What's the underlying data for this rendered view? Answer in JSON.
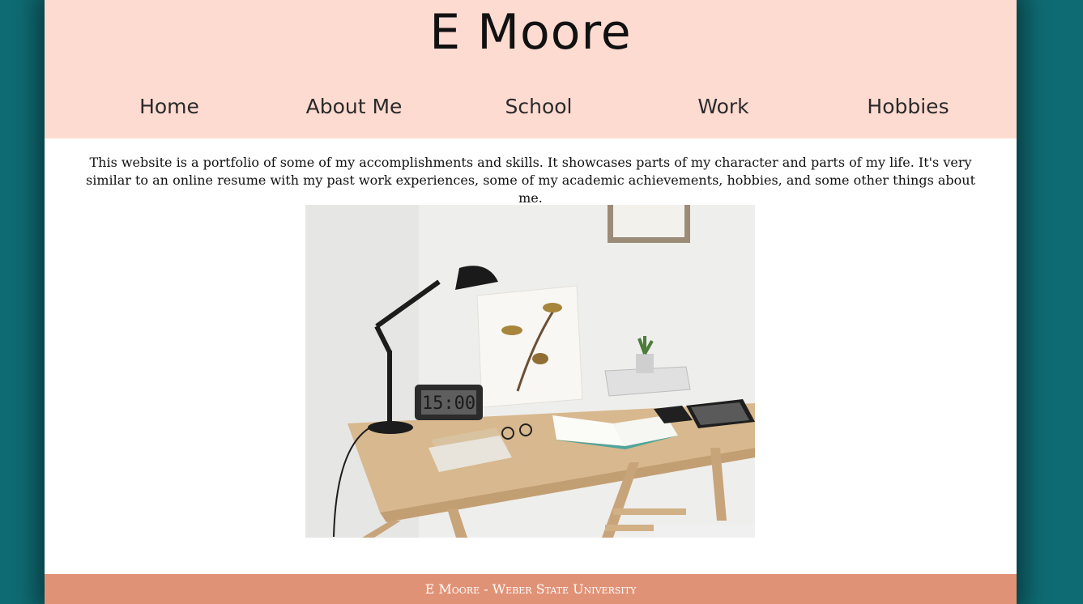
{
  "header": {
    "title": "E Moore"
  },
  "nav": {
    "items": [
      {
        "label": "Home"
      },
      {
        "label": "About Me"
      },
      {
        "label": "School"
      },
      {
        "label": "Work"
      },
      {
        "label": "Hobbies"
      }
    ]
  },
  "main": {
    "intro": "This website is a portfolio of some of my accomplishments and skills. It showcases parts of my character and parts of my life. It's very similar to an online resume with my past work experiences, some of my academic achievements, hobbies, and some other things about me.",
    "clock_display": "15:00"
  },
  "footer": {
    "text": "E Moore - Weber State University"
  },
  "colors": {
    "background": "#0f6b73",
    "header": "#fedbd1",
    "footer": "#e09276"
  }
}
